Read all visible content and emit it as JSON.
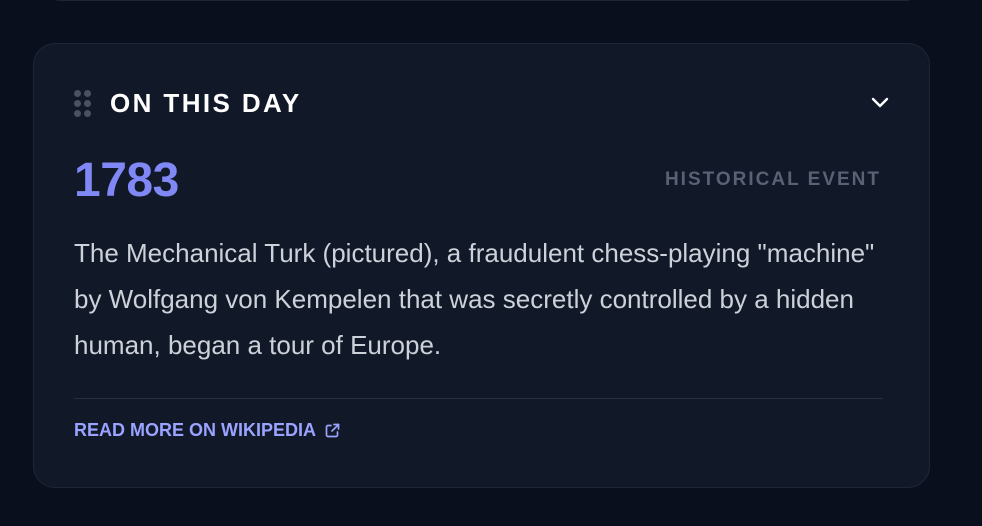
{
  "card": {
    "title": "ON THIS DAY",
    "year": "1783",
    "event_type": "HISTORICAL EVENT",
    "description": "The Mechanical Turk (pictured), a fraudulent chess-playing \"machine\" by Wolfgang von Kempelen that was secretly controlled by a hidden human, began a tour of Europe.",
    "link_label": "READ MORE ON WIKIPEDIA",
    "icons": {
      "drag": "drag-handle-icon",
      "toggle": "chevron-down-icon",
      "link": "external-link-icon"
    }
  },
  "colors": {
    "background": "#0a0f1e",
    "card": "#111827",
    "accent": "#8088f5",
    "link": "#9aa3ff",
    "muted": "#596175",
    "text": "#cdd1d9"
  }
}
